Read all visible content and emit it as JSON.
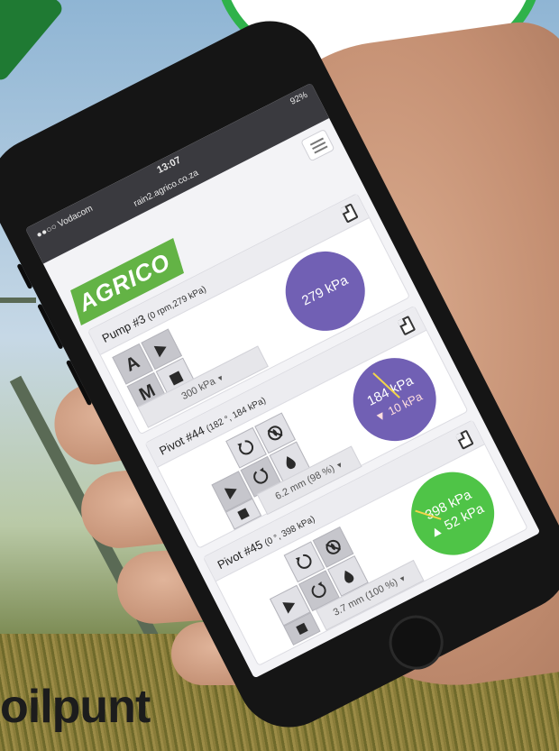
{
  "status": {
    "carrier": "●●○○ Vodacom",
    "time": "13:07",
    "battery": "92%",
    "url": "rain2.agrico.co.za"
  },
  "brand": {
    "logo": "AGRICO"
  },
  "pump": {
    "name": "Pump #3",
    "detail": "(0 rpm,279 kPa)",
    "auto_label": "A",
    "manual_label": "M",
    "setpoint": "300 kPa",
    "dial_value": "279 kPa"
  },
  "pivot44": {
    "name": "Pivot #44",
    "detail": "(182 °, 184 kPa)",
    "setpoint": "6.2 mm (98 %)",
    "dial_pressure": "184 kPa",
    "dial_secondary": "▼ 10 kPa"
  },
  "pivot45": {
    "name": "Pivot #45",
    "detail": "(0 °, 398 kPa)",
    "setpoint": "3.7 mm (100 %)",
    "dial_pressure": "398 kPa",
    "dial_secondary": "▲ 52 kPa"
  },
  "background_text": "oilpunt",
  "colors": {
    "brand_green": "#63b345",
    "dial_purple": "#7160b4",
    "dial_green": "#4fc447",
    "header_gray": "#ececf0"
  },
  "icons": {
    "menu": "hamburger-icon",
    "copy": "copy-icon",
    "play": "play-icon",
    "stop": "stop-icon",
    "reverse": "rotate-ccw-icon",
    "forward": "rotate-cw-icon",
    "no_water": "no-water-icon",
    "water": "water-drop-icon"
  }
}
